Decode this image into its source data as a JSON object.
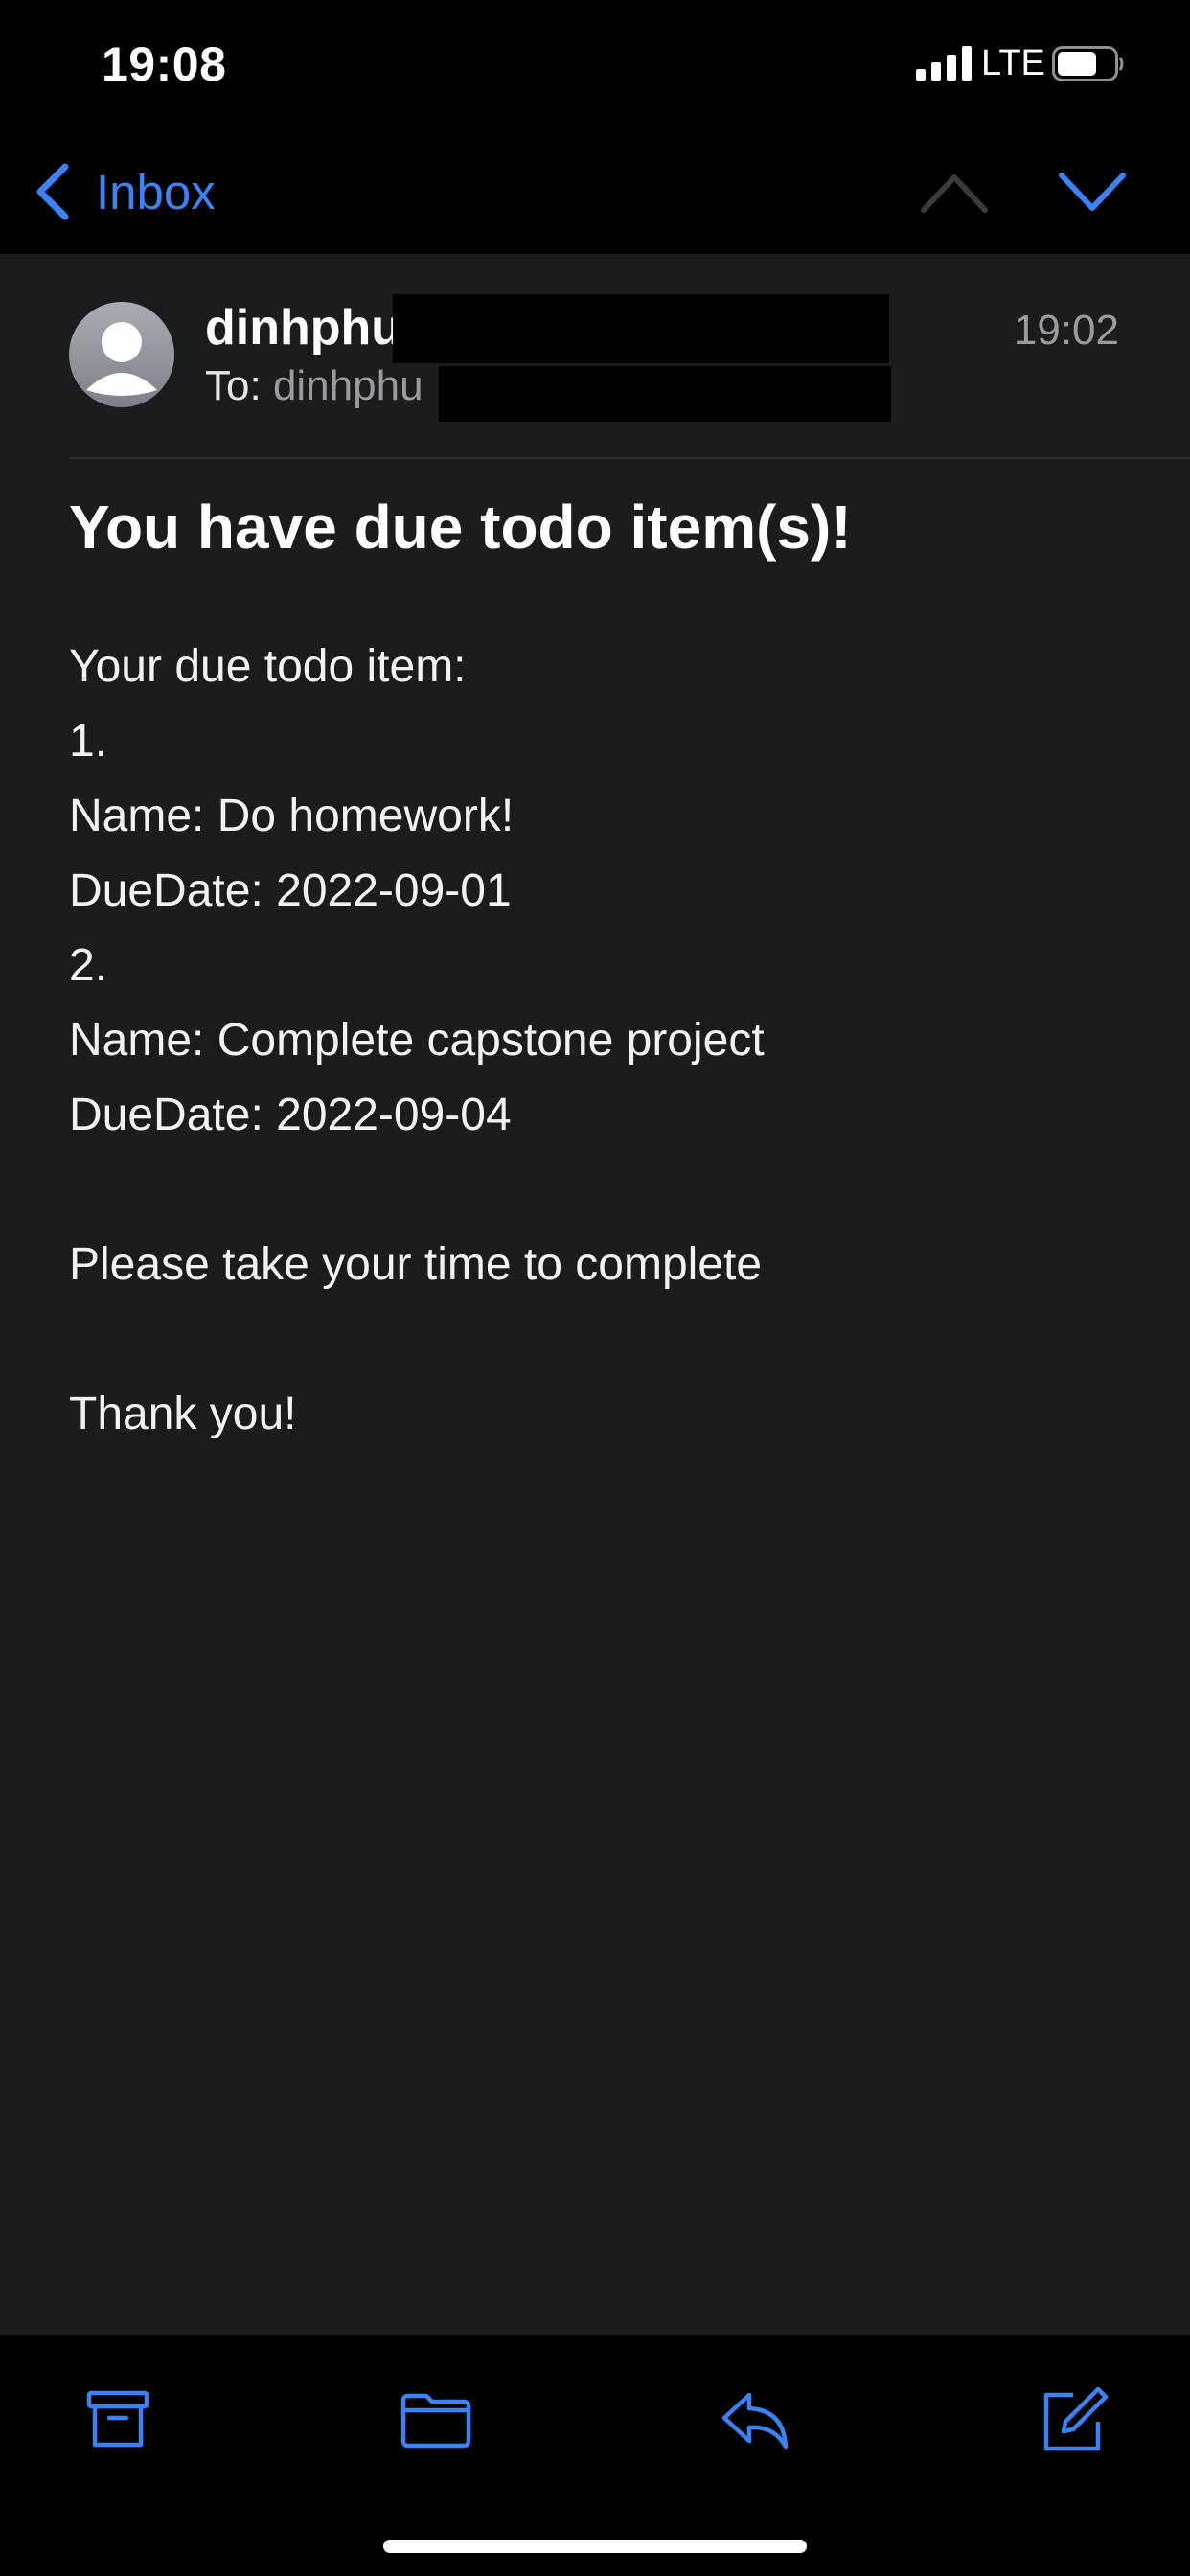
{
  "status_bar": {
    "time": "19:08",
    "network": "LTE"
  },
  "nav": {
    "back_label": "Inbox"
  },
  "message": {
    "sender": "dinhphu",
    "to_label": "To:",
    "to_value": "dinhphu",
    "time": "19:02",
    "subject": "You have due todo item(s)!",
    "body_lines": [
      "Your due todo item:",
      "1.",
      "Name: Do homework!",
      "DueDate: 2022-09-01",
      "2.",
      "Name: Complete capstone project",
      "DueDate: 2022-09-04",
      "",
      "Please take your time to complete",
      "",
      "Thank you!"
    ]
  },
  "toolbar": {
    "icons": [
      "archive-icon",
      "folder-icon",
      "reply-icon",
      "compose-icon"
    ]
  },
  "colors": {
    "accent": "#3b82f6",
    "background": "#1c1c1e",
    "bar_background": "#000000",
    "secondary_text": "#9a9aa0"
  }
}
